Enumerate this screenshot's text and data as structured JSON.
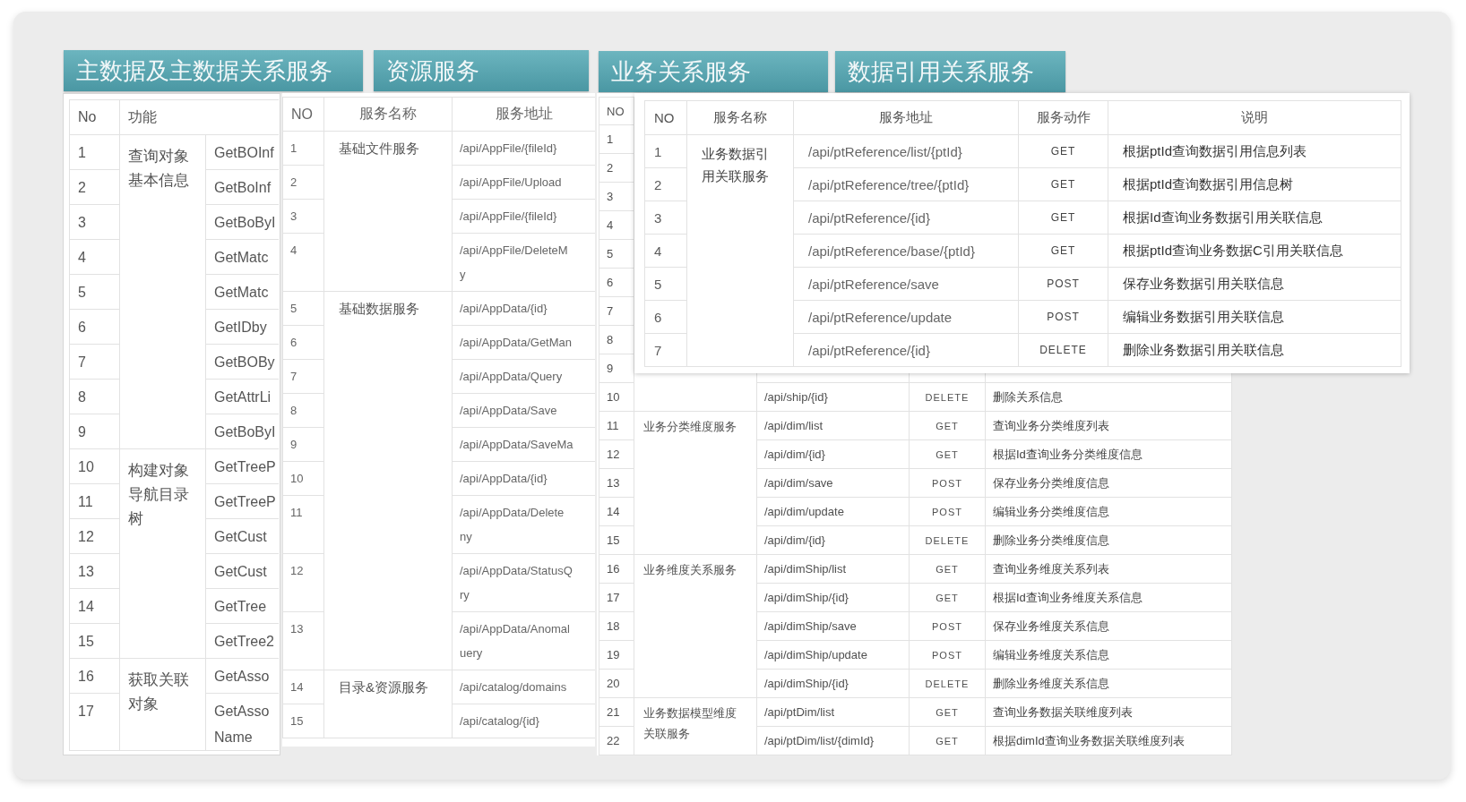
{
  "section_titles": [
    "主数据及主数据关系服务",
    "资源服务",
    "业务关系服务",
    "数据引用关系服务"
  ],
  "master_data_table": {
    "columns": [
      "No",
      "功能"
    ],
    "groups": [
      {
        "function": "查询对象基本信息",
        "rows": [
          {
            "no": "1",
            "column_3": "GetBOInf"
          },
          {
            "no": "2",
            "column_3": "GetBoInf"
          },
          {
            "no": "3",
            "column_3": "GetBoByI"
          },
          {
            "no": "4",
            "column_3": "GetMatc"
          },
          {
            "no": "5",
            "column_3": "GetMatc"
          },
          {
            "no": "6",
            "column_3": "GetIDby"
          },
          {
            "no": "7",
            "column_3": "GetBOBy"
          },
          {
            "no": "8",
            "column_3": "GetAttrLi"
          },
          {
            "no": "9",
            "column_3": "GetBoByI"
          }
        ]
      },
      {
        "function": "构建对象导航目录树",
        "rows": [
          {
            "no": "10",
            "column_3": "GetTreeP"
          },
          {
            "no": "11",
            "column_3": "GetTreeP"
          },
          {
            "no": "12",
            "column_3": "GetCust"
          },
          {
            "no": "13",
            "column_3": "GetCust"
          },
          {
            "no": "14",
            "column_3": "GetTree"
          },
          {
            "no": "15",
            "column_3": "GetTree2"
          }
        ]
      },
      {
        "function": "获取关联对象",
        "rows": [
          {
            "no": "16",
            "column_3": "GetAsso"
          },
          {
            "no": "17",
            "column_3": "GetAsso\nName"
          }
        ]
      }
    ]
  },
  "resource_table": {
    "columns": [
      "NO",
      "服务名称",
      "服务地址"
    ],
    "groups": [
      {
        "service_name": "基础文件服务",
        "rows": [
          {
            "no": "1",
            "address": "/api/AppFile/{fileId}"
          },
          {
            "no": "2",
            "address": "/api/AppFile/Upload"
          },
          {
            "no": "3",
            "address": "/api/AppFile/{fileId}"
          },
          {
            "no": "4",
            "address": "/api/AppFile/DeleteM\ny"
          }
        ]
      },
      {
        "service_name": "基础数据服务",
        "rows": [
          {
            "no": "5",
            "address": "/api/AppData/{id}"
          },
          {
            "no": "6",
            "address": "/api/AppData/GetMan"
          },
          {
            "no": "7",
            "address": "/api/AppData/Query"
          },
          {
            "no": "8",
            "address": "/api/AppData/Save"
          },
          {
            "no": "9",
            "address": "/api/AppData/SaveMa"
          },
          {
            "no": "10",
            "address": "/api/AppData/{id}"
          },
          {
            "no": "11",
            "address": "/api/AppData/Delete\nny"
          },
          {
            "no": "12",
            "address": "/api/AppData/StatusQ\nry"
          },
          {
            "no": "13",
            "address": "/api/AppData/Anomal\nuery"
          }
        ]
      },
      {
        "service_name": "目录&资源服务",
        "rows": [
          {
            "no": "14",
            "address": "/api/catalog/domains"
          },
          {
            "no": "15",
            "address": "/api/catalog/{id}"
          }
        ]
      }
    ]
  },
  "business_relation_table": {
    "columns": [
      "NO"
    ],
    "groups": [
      {
        "rows": [
          {
            "no": "1"
          },
          {
            "no": "2"
          },
          {
            "no": "3"
          },
          {
            "no": "4"
          },
          {
            "no": "5"
          },
          {
            "no": "6"
          },
          {
            "no": "7"
          },
          {
            "no": "8"
          },
          {
            "no": "9"
          },
          {
            "no": "10",
            "address": "/api/ship/{id}",
            "action": "DELETE",
            "description": "删除关系信息"
          }
        ]
      },
      {
        "service_name": "业务分类维度服务",
        "rows": [
          {
            "no": "11",
            "address": "/api/dim/list",
            "action": "GET",
            "description": "查询业务分类维度列表"
          },
          {
            "no": "12",
            "address": "/api/dim/{id}",
            "action": "GET",
            "description": "根据Id查询业务分类维度信息"
          },
          {
            "no": "13",
            "address": "/api/dim/save",
            "action": "POST",
            "description": "保存业务分类维度信息"
          },
          {
            "no": "14",
            "address": "/api/dim/update",
            "action": "POST",
            "description": "编辑业务分类维度信息"
          },
          {
            "no": "15",
            "address": "/api/dim/{id}",
            "action": "DELETE",
            "description": "删除业务分类维度信息"
          }
        ]
      },
      {
        "service_name": "业务维度关系服务",
        "rows": [
          {
            "no": "16",
            "address": "/api/dimShip/list",
            "action": "GET",
            "description": "查询业务维度关系列表"
          },
          {
            "no": "17",
            "address": "/api/dimShip/{id}",
            "action": "GET",
            "description": "根据Id查询业务维度关系信息"
          },
          {
            "no": "18",
            "address": "/api/dimShip/save",
            "action": "POST",
            "description": "保存业务维度关系信息"
          },
          {
            "no": "19",
            "address": "/api/dimShip/update",
            "action": "POST",
            "description": "编辑业务维度关系信息"
          },
          {
            "no": "20",
            "address": "/api/dimShip/{id}",
            "action": "DELETE",
            "description": "删除业务维度关系信息"
          }
        ]
      },
      {
        "service_name": "业务数据模型维度关联服务",
        "rows": [
          {
            "no": "21",
            "address": "/api/ptDim/list",
            "action": "GET",
            "description": "查询业务数据关联维度列表"
          },
          {
            "no": "22",
            "address": "/api/ptDim/list/{dimId}",
            "action": "GET",
            "description": "根据dimId查询业务数据关联维度列表"
          }
        ]
      }
    ]
  },
  "data_reference_table": {
    "columns": [
      "NO",
      "服务名称",
      "服务地址",
      "服务动作",
      "说明"
    ],
    "groups": [
      {
        "service_name": "业务数据引用关联服务",
        "rows": [
          {
            "no": "1",
            "address": "/api/ptReference/list/{ptId}",
            "action": "GET",
            "description": "根据ptId查询数据引用信息列表"
          },
          {
            "no": "2",
            "address": "/api/ptReference/tree/{ptId}",
            "action": "GET",
            "description": "根据ptId查询数据引用信息树"
          },
          {
            "no": "3",
            "address": "/api/ptReference/{id}",
            "action": "GET",
            "description": "根据Id查询业务数据引用关联信息"
          },
          {
            "no": "4",
            "address": "/api/ptReference/base/{ptId}",
            "action": "GET",
            "description": "根据ptId查询业务数据C引用关联信息"
          },
          {
            "no": "5",
            "address": "/api/ptReference/save",
            "action": "POST",
            "description": "保存业务数据引用关联信息"
          },
          {
            "no": "6",
            "address": "/api/ptReference/update",
            "action": "POST",
            "description": "编辑业务数据引用关联信息"
          },
          {
            "no": "7",
            "address": "/api/ptReference/{id}",
            "action": "DELETE",
            "description": "删除业务数据引用关联信息"
          }
        ]
      }
    ]
  }
}
